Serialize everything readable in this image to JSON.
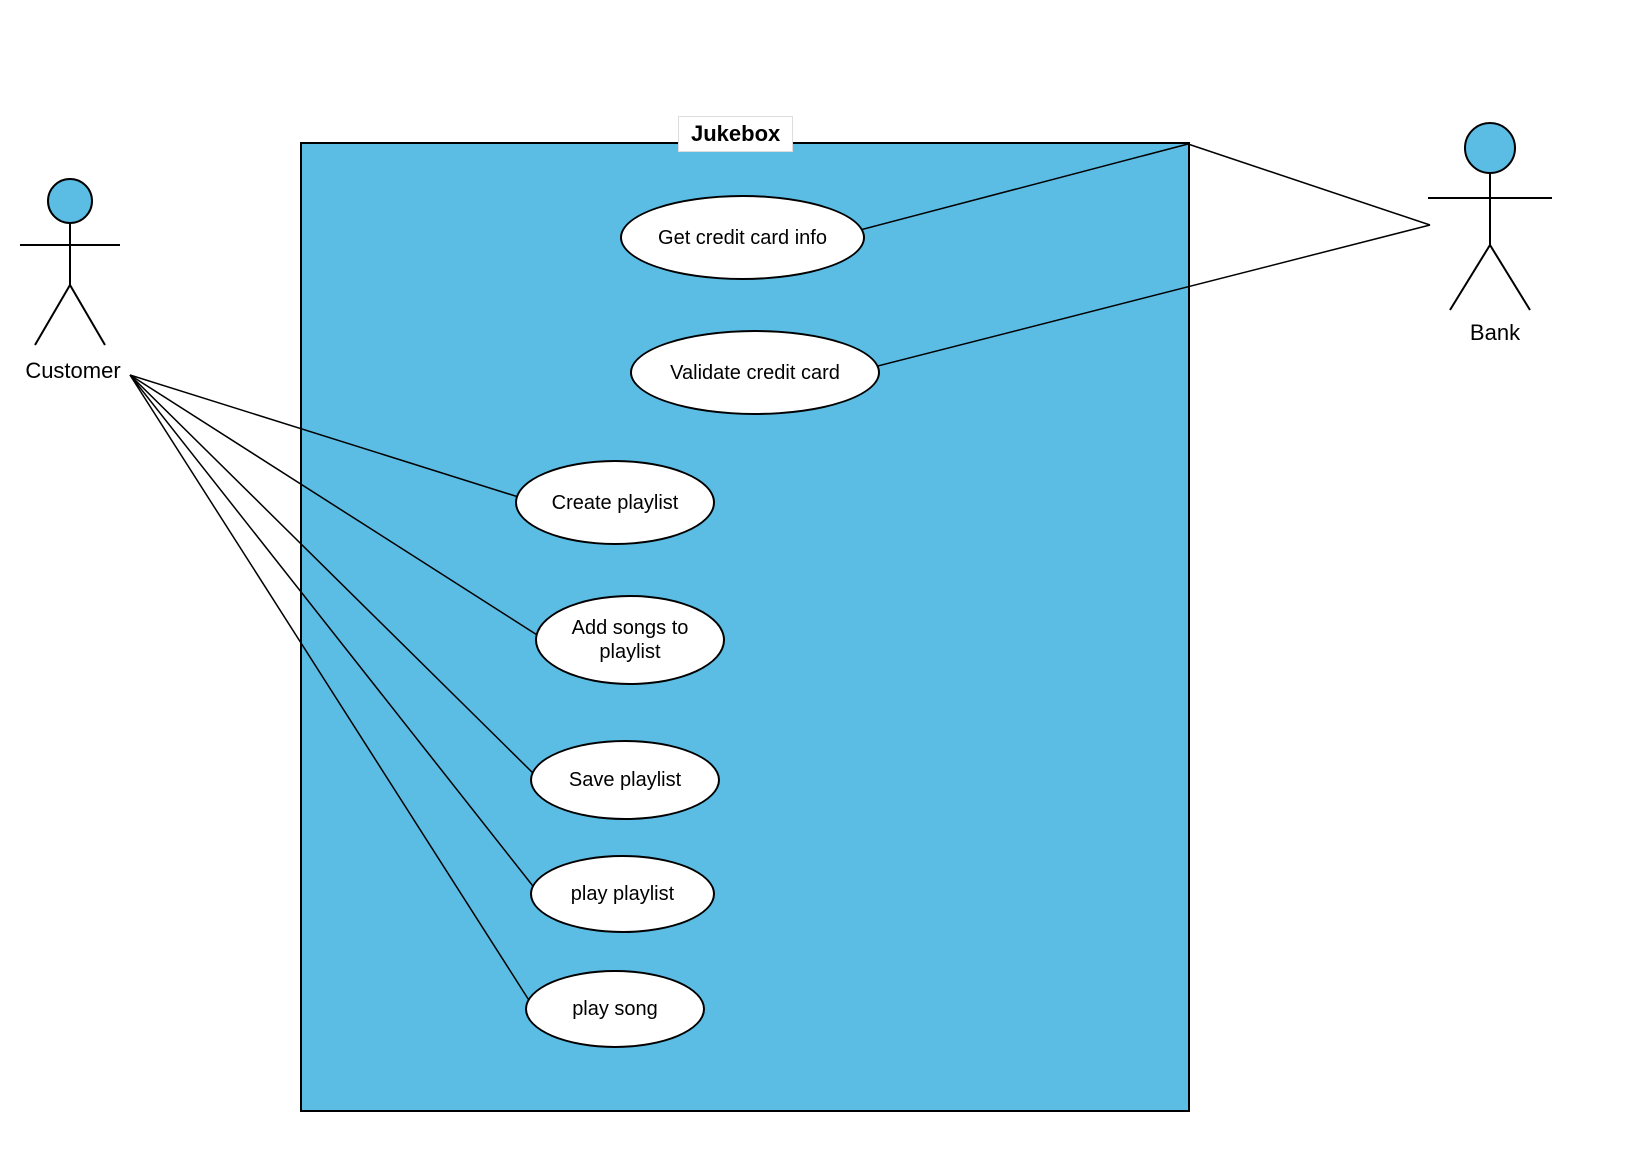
{
  "system": {
    "title": "Jukebox"
  },
  "actors": {
    "customer": {
      "label": "Customer"
    },
    "bank": {
      "label": "Bank"
    }
  },
  "usecases": {
    "get_cc_info": {
      "label": "Get credit card info"
    },
    "validate_cc": {
      "label": "Validate credit card"
    },
    "create_playlist": {
      "label": "Create playlist"
    },
    "add_songs": {
      "label": "Add songs to playlist"
    },
    "save_playlist": {
      "label": "Save playlist"
    },
    "play_playlist": {
      "label": "play playlist"
    },
    "play_song": {
      "label": "play song"
    }
  },
  "colors": {
    "system_fill": "#5bbce4",
    "actor_head": "#5bbce4"
  }
}
